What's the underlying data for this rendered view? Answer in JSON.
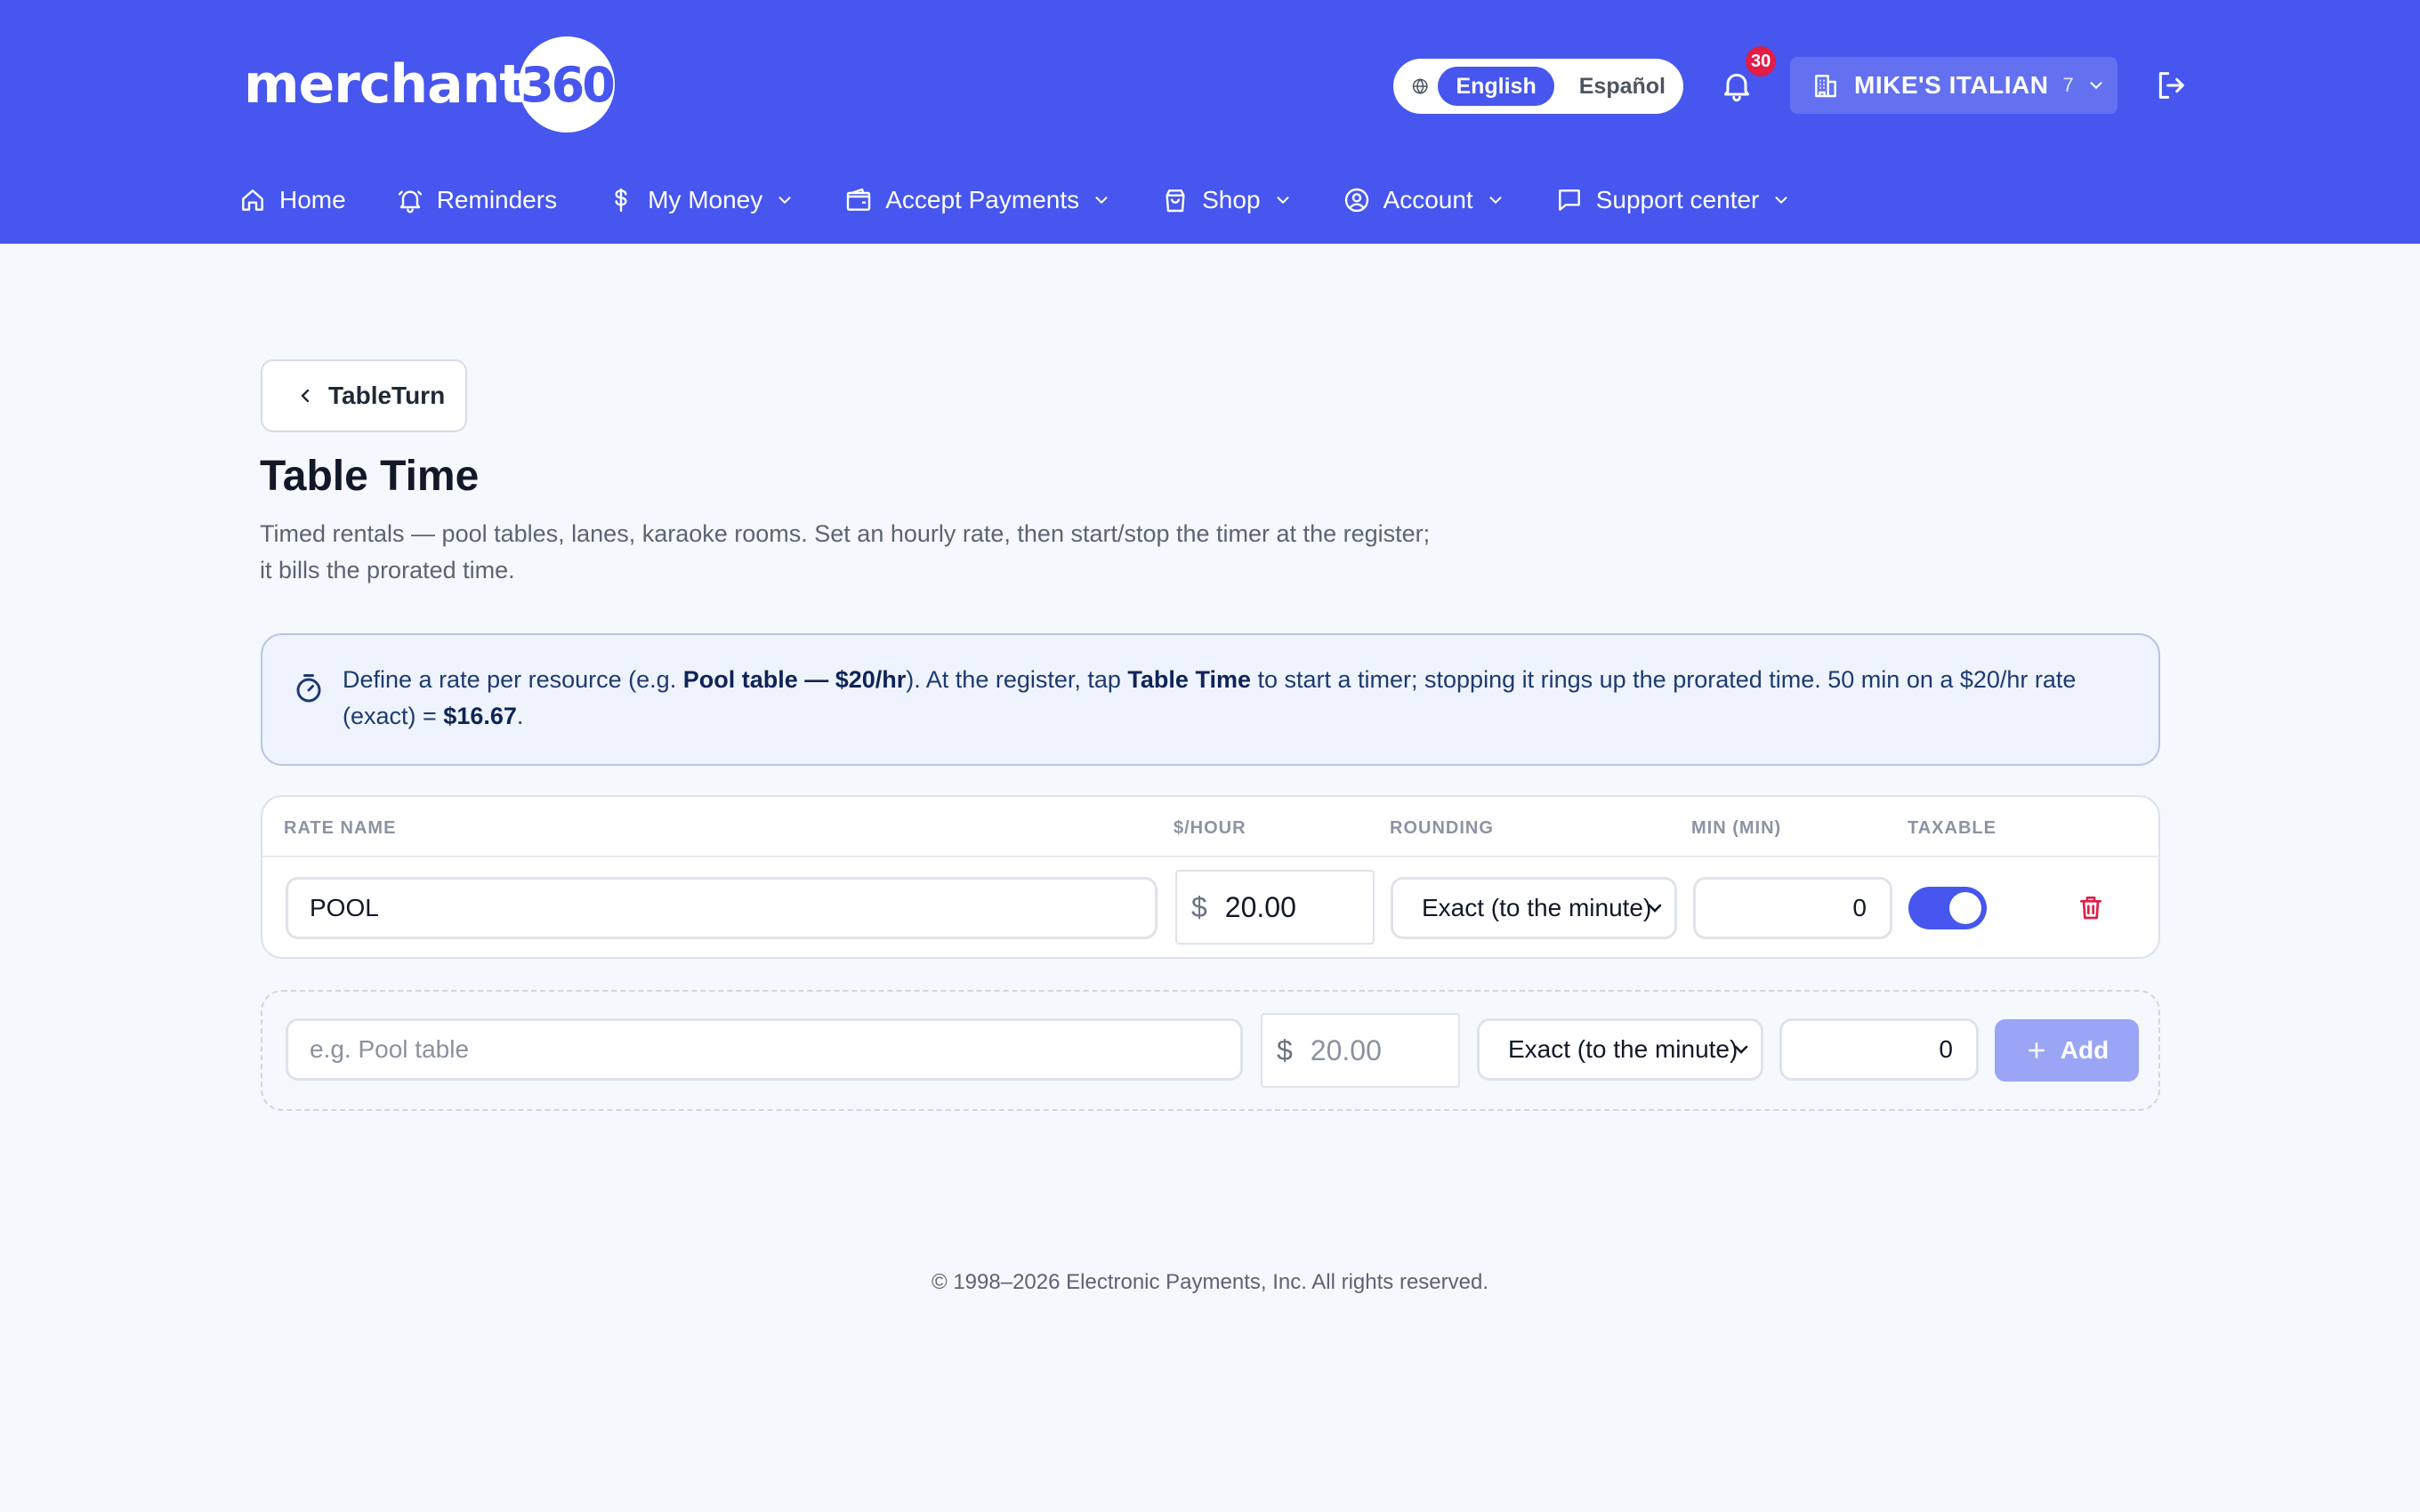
{
  "header": {
    "logo_text": "merchant",
    "logo_circle_text": "360",
    "language": {
      "active": "English",
      "inactive": "Español"
    },
    "notifications": {
      "count": "30"
    },
    "merchant": {
      "name": "MIKE'S ITALIAN",
      "count": "7"
    }
  },
  "nav": {
    "home": "Home",
    "reminders": "Reminders",
    "my_money": "My Money",
    "accept_payments": "Accept Payments",
    "shop": "Shop",
    "account": "Account",
    "support": "Support center"
  },
  "page": {
    "back_label": "TableTurn",
    "title": "Table Time",
    "description": "Timed rentals — pool tables, lanes, karaoke rooms. Set an hourly rate, then start/stop the timer at the register; it bills the prorated time."
  },
  "info": {
    "t1": "Define a rate per resource (e.g. ",
    "b1": "Pool table — $20/hr",
    "t2": "). At the register, tap ",
    "b2": "Table Time",
    "t3": " to start a timer; stopping it rings up the prorated time. 50 min on a $20/hr rate (exact) = ",
    "b3": "$16.67",
    "t4": "."
  },
  "table": {
    "headers": {
      "name": "RATE NAME",
      "rate": "$/HOUR",
      "rounding": "ROUNDING",
      "min": "MIN (MIN)",
      "taxable": "TAXABLE"
    },
    "rows": [
      {
        "name": "POOL",
        "currency": "$",
        "rate": "20.00",
        "rounding": "Exact (to the minute)",
        "min": "0",
        "taxable": true
      }
    ]
  },
  "new_rate": {
    "name_placeholder": "e.g. Pool table",
    "currency": "$",
    "rate_placeholder": "20.00",
    "rounding": "Exact (to the minute)",
    "min": "0",
    "add_label": "Add"
  },
  "footer": {
    "copyright": "© 1998–2026 Electronic Payments, Inc. All rights reserved."
  },
  "colors": {
    "brand": "#4656ee",
    "danger": "#e11d48",
    "add_button": "#9aa5f6"
  }
}
